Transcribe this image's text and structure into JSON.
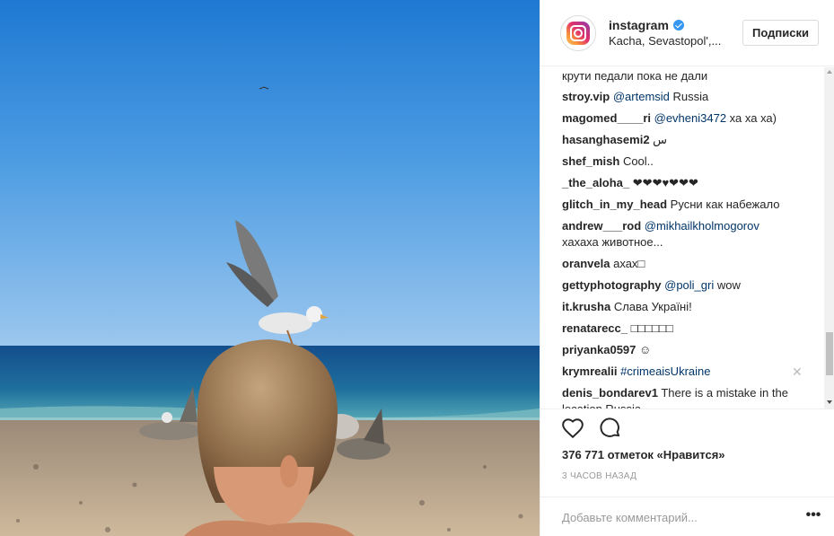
{
  "post": {
    "username": "instagram",
    "location": "Kacha, Sevastopol',...",
    "follow_label": "Подписки"
  },
  "comments": [
    {
      "user": "",
      "text": "крути педали пока не дали"
    },
    {
      "user": "stroy.vip",
      "mention": "@artemsid",
      "text": " Russia"
    },
    {
      "user": "magomed____ri",
      "mention": "@evheni3472",
      "text": " ха ха ха)"
    },
    {
      "user": "hasanghasemi2",
      "text": "س"
    },
    {
      "user": "shef_mish",
      "text": "Cool.."
    },
    {
      "user": "_the_aloha_",
      "text": "❤❤❤♥❤❤❤"
    },
    {
      "user": "glitch_in_my_head",
      "text": "Русни как набежало"
    },
    {
      "user": "andrew___rod",
      "mention": "@mikhailkholmogorov",
      "text": "хахаха животное..."
    },
    {
      "user": "oranvela",
      "text": "ахах□"
    },
    {
      "user": "gettyphotography",
      "mention": "@poli_gri",
      "text": " wow"
    },
    {
      "user": "it.krusha",
      "text": "Слава Україні!"
    },
    {
      "user": "renatarecc_",
      "text": "□□□□□□"
    },
    {
      "user": "priyanka0597",
      "text": "☺"
    },
    {
      "user": "krymrealii",
      "mention": "#crimeaisUkraine",
      "text": ""
    },
    {
      "user": "denis_bondarev1",
      "text": "There is a mistake in the location  Russia"
    }
  ],
  "likes_text": "376 771 отметок «Нравится»",
  "time_text": "3 ЧАСОВ НАЗАД",
  "add_comment_placeholder": "Добавьте комментарий...",
  "more_label": "•••",
  "close_label": "✕",
  "icons": {
    "heart": "heart-icon",
    "comment": "comment-icon",
    "verified": "verified-badge-icon",
    "logo": "instagram-logo-icon"
  },
  "colors": {
    "mention": "#003569",
    "verified": "#3897f0",
    "meta": "#999999"
  }
}
